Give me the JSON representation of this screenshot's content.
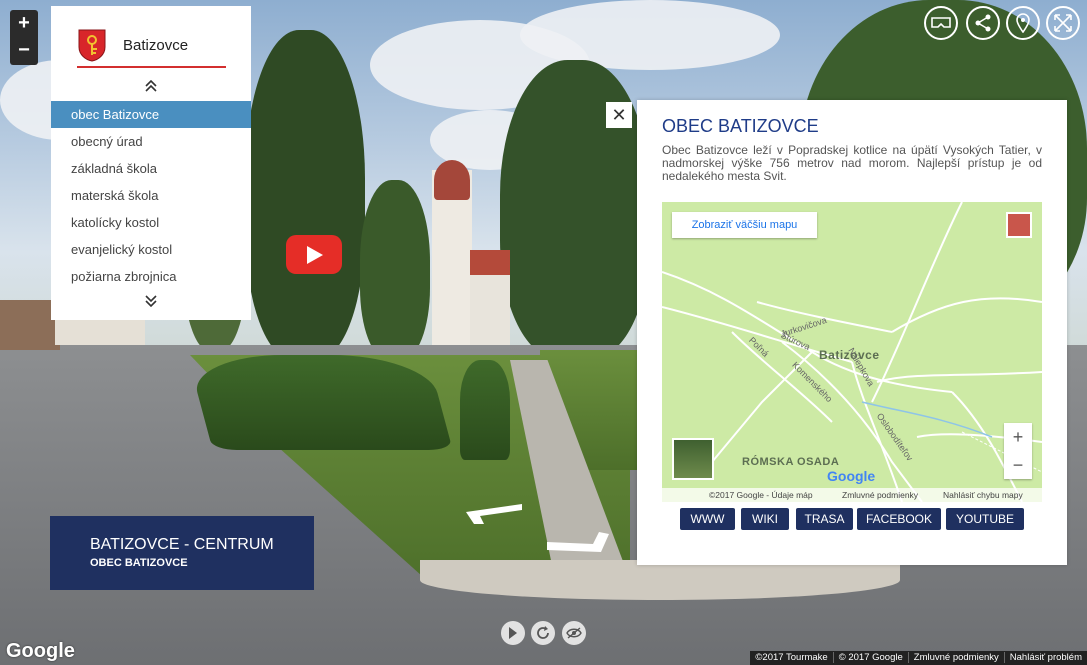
{
  "zoom": {
    "plus": "+",
    "minus": "−"
  },
  "menu": {
    "brand": "Batizovce",
    "crest_icon": "coat-of-arms-icon",
    "items": [
      {
        "label": "obec Batizovce",
        "active": true
      },
      {
        "label": "obecný úrad"
      },
      {
        "label": "základná škola"
      },
      {
        "label": "materská škola"
      },
      {
        "label": "katolícky kostol"
      },
      {
        "label": "evanjelický kostol"
      },
      {
        "label": "požiarna zbrojnica"
      }
    ]
  },
  "top_icons": [
    "vr-headset-icon",
    "share-icon",
    "map-pin-icon",
    "fullscreen-icon"
  ],
  "panel": {
    "close": "✕",
    "title": "OBEC BATIZOVCE",
    "description": "Obec Batizovce leží v Popradskej kotlice na úpätí Vysokých Tatier, v nadmorskej výške 756 metrov nad morom. Najlepší prístup je od nedalekého mesta Svit.",
    "map": {
      "bigger_map": "Zobraziť väčšiu mapu",
      "place": "Batizovce",
      "area": "RÓMSKA OSADA",
      "streets": [
        "Jurkovičova",
        "Štúrova",
        "Poľná",
        "Komenského",
        "Nálepkova",
        "Oslobodíteľov"
      ],
      "logo": "Google",
      "attribution": [
        "©2017 Google - Údaje máp",
        "Zmluvné podmienky",
        "Nahlásiť chybu mapy"
      ]
    },
    "links": [
      "WWW",
      "WIKI",
      "TRASA",
      "FACEBOOK",
      "YOUTUBE"
    ]
  },
  "location": {
    "title": "BATIZOVCE - CENTRUM",
    "subtitle": "OBEC BATIZOVCE"
  },
  "google_logo": "Google",
  "footer": [
    "©2017 Tourmake",
    "© 2017 Google",
    "Zmluvné podmienky",
    "Nahlásiť problém"
  ],
  "colors": {
    "navy": "#1f3060",
    "active": "#4a8fc0",
    "youtube": "#e52d27",
    "title": "#1f3c88"
  }
}
